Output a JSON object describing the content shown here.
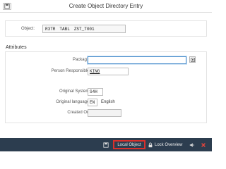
{
  "window": {
    "title": "Create Object Directory Entry"
  },
  "object": {
    "label": "Object:",
    "parts": [
      "R3TR",
      "TABL",
      "ZST_T001"
    ]
  },
  "attributes": {
    "heading": "Attributes",
    "package_label": "Package:",
    "package_value": "",
    "person_label": "Person Responsible:",
    "person_value": "KING",
    "orig_system_label": "Original System:",
    "orig_system_value": "S4H",
    "orig_lang_label": "Original language:",
    "orig_lang_code": "EN",
    "orig_lang_name": "English",
    "created_on_label": "Created On:",
    "created_on_value": ""
  },
  "footer": {
    "local_object_label": "Local Object",
    "lock_overview_label": "Lock Overview"
  },
  "colors": {
    "footer_bg": "#2c3d4f",
    "highlight": "#d9302c",
    "focus_border": "#4c8fcd"
  },
  "icons": [
    "save-icon",
    "value-help-icon",
    "lock-icon",
    "delete-icon",
    "close-icon",
    "speaker-icon"
  ]
}
